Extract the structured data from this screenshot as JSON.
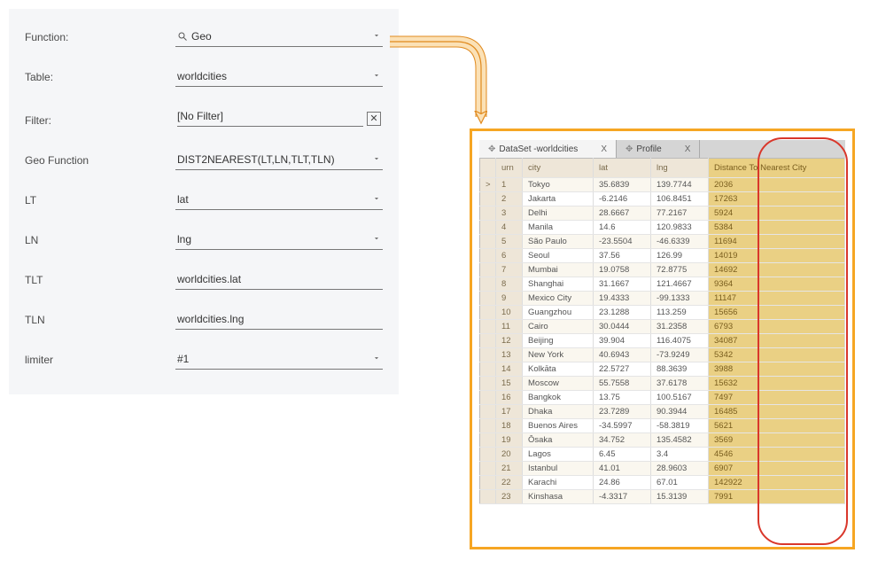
{
  "form": {
    "function": {
      "label": "Function:",
      "value": "Geo"
    },
    "table": {
      "label": "Table:",
      "value": "worldcities"
    },
    "filter": {
      "label": "Filter:",
      "value": "[No Filter]"
    },
    "geofn": {
      "label": "Geo Function",
      "value": "DIST2NEAREST(LT,LN,TLT,TLN)"
    },
    "lt": {
      "label": "LT",
      "value": "lat"
    },
    "ln": {
      "label": "LN",
      "value": "lng"
    },
    "tlt": {
      "label": "TLT",
      "value": "worldcities.lat"
    },
    "tln": {
      "label": "TLN",
      "value": "worldcities.lng"
    },
    "limiter": {
      "label": "limiter",
      "value": "#1"
    }
  },
  "tabs": [
    {
      "label": "DataSet -worldcities",
      "active": true
    },
    {
      "label": "Profile",
      "active": false
    }
  ],
  "columns": {
    "urn": "urn",
    "city": "city",
    "lat": "lat",
    "lng": "lng",
    "dist": "Distance To Nearest City"
  },
  "rows": [
    {
      "urn": "1",
      "city": "Tokyo",
      "lat": "35.6839",
      "lng": "139.7744",
      "dist": "2036",
      "selected": true
    },
    {
      "urn": "2",
      "city": "Jakarta",
      "lat": "-6.2146",
      "lng": "106.8451",
      "dist": "17263"
    },
    {
      "urn": "3",
      "city": "Delhi",
      "lat": "28.6667",
      "lng": "77.2167",
      "dist": "5924"
    },
    {
      "urn": "4",
      "city": "Manila",
      "lat": "14.6",
      "lng": "120.9833",
      "dist": "5384"
    },
    {
      "urn": "5",
      "city": "São Paulo",
      "lat": "-23.5504",
      "lng": "-46.6339",
      "dist": "11694"
    },
    {
      "urn": "6",
      "city": "Seoul",
      "lat": "37.56",
      "lng": "126.99",
      "dist": "14019"
    },
    {
      "urn": "7",
      "city": "Mumbai",
      "lat": "19.0758",
      "lng": "72.8775",
      "dist": "14692"
    },
    {
      "urn": "8",
      "city": "Shanghai",
      "lat": "31.1667",
      "lng": "121.4667",
      "dist": "9364"
    },
    {
      "urn": "9",
      "city": "Mexico City",
      "lat": "19.4333",
      "lng": "-99.1333",
      "dist": "11147"
    },
    {
      "urn": "10",
      "city": "Guangzhou",
      "lat": "23.1288",
      "lng": "113.259",
      "dist": "15656"
    },
    {
      "urn": "11",
      "city": "Cairo",
      "lat": "30.0444",
      "lng": "31.2358",
      "dist": "6793"
    },
    {
      "urn": "12",
      "city": "Beijing",
      "lat": "39.904",
      "lng": "116.4075",
      "dist": "34087"
    },
    {
      "urn": "13",
      "city": "New York",
      "lat": "40.6943",
      "lng": "-73.9249",
      "dist": "5342"
    },
    {
      "urn": "14",
      "city": "Kolkāta",
      "lat": "22.5727",
      "lng": "88.3639",
      "dist": "3988"
    },
    {
      "urn": "15",
      "city": "Moscow",
      "lat": "55.7558",
      "lng": "37.6178",
      "dist": "15632"
    },
    {
      "urn": "16",
      "city": "Bangkok",
      "lat": "13.75",
      "lng": "100.5167",
      "dist": "7497"
    },
    {
      "urn": "17",
      "city": "Dhaka",
      "lat": "23.7289",
      "lng": "90.3944",
      "dist": "16485"
    },
    {
      "urn": "18",
      "city": "Buenos Aires",
      "lat": "-34.5997",
      "lng": "-58.3819",
      "dist": "5621"
    },
    {
      "urn": "19",
      "city": "Ōsaka",
      "lat": "34.752",
      "lng": "135.4582",
      "dist": "3569"
    },
    {
      "urn": "20",
      "city": "Lagos",
      "lat": "6.45",
      "lng": "3.4",
      "dist": "4546"
    },
    {
      "urn": "21",
      "city": "Istanbul",
      "lat": "41.01",
      "lng": "28.9603",
      "dist": "6907"
    },
    {
      "urn": "22",
      "city": "Karachi",
      "lat": "24.86",
      "lng": "67.01",
      "dist": "142922"
    },
    {
      "urn": "23",
      "city": "Kinshasa",
      "lat": "-4.3317",
      "lng": "15.3139",
      "dist": "7991"
    }
  ]
}
